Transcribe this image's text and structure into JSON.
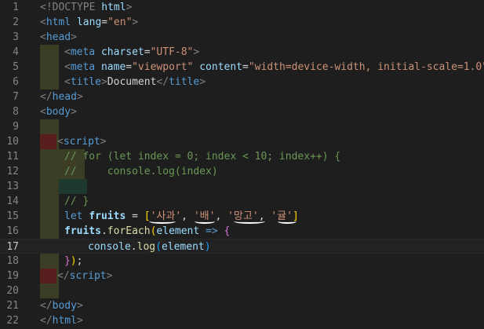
{
  "editor": {
    "line_numbers": [
      "1",
      "2",
      "3",
      "4",
      "5",
      "6",
      "7",
      "8",
      "9",
      "10",
      "11",
      "12",
      "13",
      "14",
      "15",
      "16",
      "17",
      "18",
      "19",
      "20",
      "21",
      "22"
    ],
    "active_line": "17",
    "lines": {
      "l1_a": "<!DOCTYPE ",
      "l1_b": "html",
      "l1_c": ">",
      "l2_a": "<",
      "l2_b": "html",
      "l2_c": " lang",
      "l2_d": "=",
      "l2_e": "\"en\"",
      "l2_f": ">",
      "l3_a": "<",
      "l3_b": "head",
      "l3_c": ">",
      "l4_a": "<",
      "l4_b": "meta",
      "l4_c": " charset",
      "l4_d": "=",
      "l4_e": "\"UTF-8\"",
      "l4_f": ">",
      "l5_a": "<",
      "l5_b": "meta",
      "l5_c": " name",
      "l5_d": "=",
      "l5_e": "\"viewport\"",
      "l5_f": " content",
      "l5_g": "=",
      "l5_h": "\"width=device-width, initial-scale=1.0\"",
      "l5_i": ">",
      "l6_a": "<",
      "l6_b": "title",
      "l6_c": ">",
      "l6_d": "Document",
      "l6_e": "</",
      "l6_f": "title",
      "l6_g": ">",
      "l7_a": "</",
      "l7_b": "head",
      "l7_c": ">",
      "l8_a": "<",
      "l8_b": "body",
      "l8_c": ">",
      "l10_a": "<",
      "l10_b": "script",
      "l10_c": ">",
      "l11": "// for (let index = 0; index < 10; index++) {",
      "l12": "//     console.log(index)",
      "l14": "// }",
      "l15_a": "let ",
      "l15_b": "fruits",
      "l15_c": " = ",
      "l15_d": "[",
      "l15_e": "'사과'",
      "l15_f": ", ",
      "l15_g": "'배'",
      "l15_h": ", ",
      "l15_i": "'망고'",
      "l15_j": ", ",
      "l15_k": "'귤'",
      "l15_l": "]",
      "l16_a": "fruits",
      "l16_b": ".",
      "l16_c": "forEach",
      "l16_d": "(",
      "l16_e": "element",
      "l16_f": " => ",
      "l16_g": "{",
      "l17_a": "console",
      "l17_b": ".",
      "l17_c": "log",
      "l17_d": "(",
      "l17_e": "element",
      "l17_f": ")",
      "l18_a": "}",
      "l18_b": ")",
      "l18_c": ";",
      "l19_a": "</",
      "l19_b": "script",
      "l19_c": ">",
      "l21_a": "</",
      "l21_b": "body",
      "l21_c": ">",
      "l22_a": "</",
      "l22_b": "html",
      "l22_c": ">"
    }
  },
  "colors": {
    "background": "#1e1e1e",
    "tag": "#569cd6",
    "attribute": "#9cdcfe",
    "string": "#ce9178",
    "comment": "#6a9955",
    "function": "#dcdcaa",
    "bracket_gold": "#ffd700",
    "bracket_purple": "#da70d6"
  }
}
